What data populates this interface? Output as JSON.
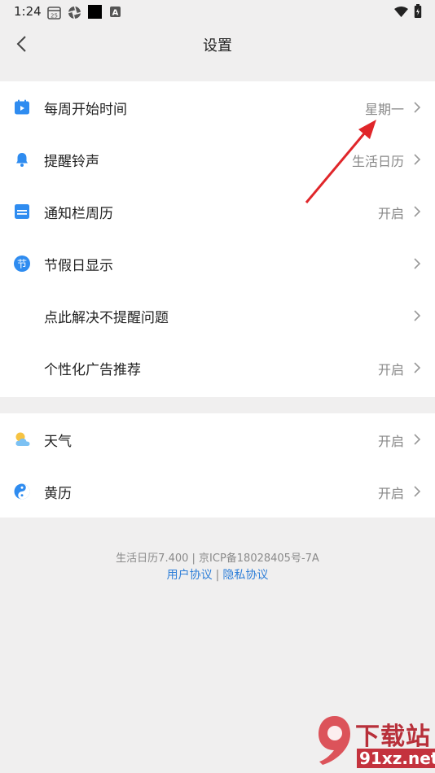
{
  "status_bar": {
    "time": "1:24",
    "calendar_day": "25"
  },
  "header": {
    "title": "设置"
  },
  "settings_group1": [
    {
      "label": "每周开始时间",
      "value": "星期一",
      "icon": "calendar-icon"
    },
    {
      "label": "提醒铃声",
      "value": "生活日历",
      "icon": "bell-icon"
    },
    {
      "label": "通知栏周历",
      "value": "开启",
      "icon": "notification-calendar-icon"
    },
    {
      "label": "节假日显示",
      "value": "",
      "icon": "holiday-icon",
      "icon_text": "节"
    },
    {
      "label": "点此解决不提醒问题",
      "value": ""
    },
    {
      "label": "个性化广告推荐",
      "value": "开启"
    }
  ],
  "settings_group2": [
    {
      "label": "天气",
      "value": "开启",
      "icon": "weather-icon"
    },
    {
      "label": "黄历",
      "value": "开启",
      "icon": "yin-yang-icon"
    }
  ],
  "footer": {
    "version_text": "生活日历7.400 | 京ICP备18028405号-7A",
    "user_agreement": "用户协议",
    "separator": "|",
    "privacy_policy": "隐私协议"
  },
  "watermark": {
    "line1": "下载站",
    "line2": "91xz.net"
  },
  "colors": {
    "accent": "#2f8cf0",
    "link": "#2f7fd8",
    "annotation_arrow": "#e0262a"
  }
}
